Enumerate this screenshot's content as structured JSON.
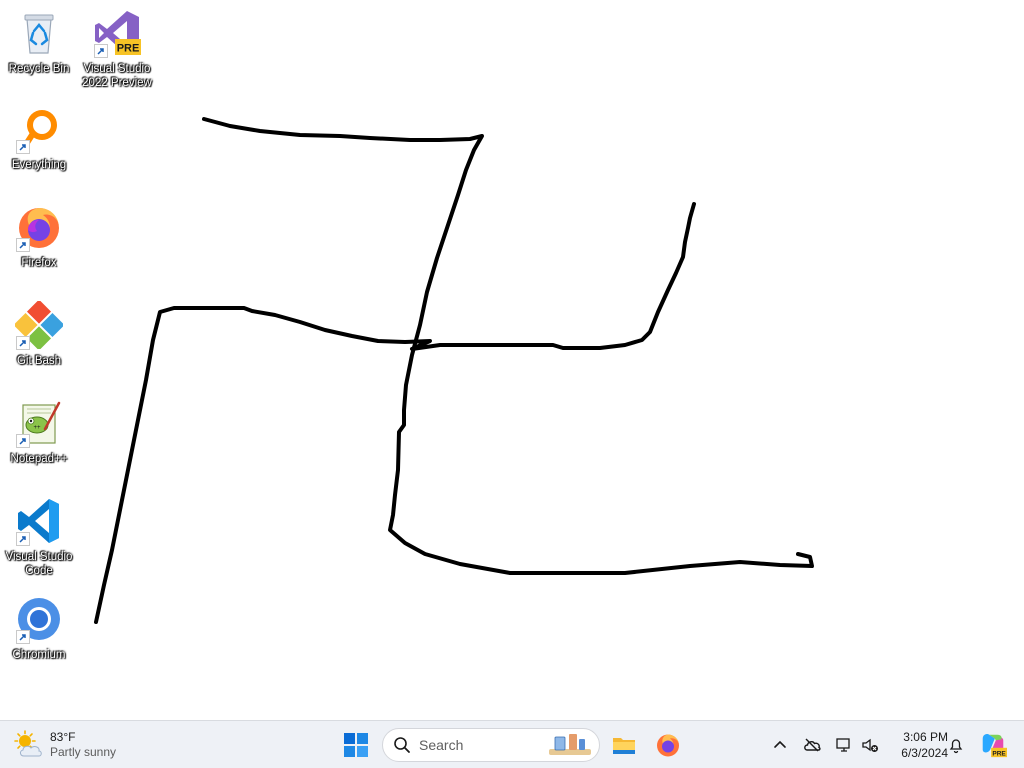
{
  "desktop": {
    "icons": [
      {
        "label": "Recycle Bin",
        "icon": "recycle-bin-icon"
      },
      {
        "label": "Visual Studio 2022 Preview",
        "icon": "visual-studio-preview-icon",
        "badge": "PRE"
      },
      {
        "label": "Everything",
        "icon": "everything-search-icon"
      },
      {
        "label": "Firefox",
        "icon": "firefox-icon"
      },
      {
        "label": "Git Bash",
        "icon": "git-bash-icon"
      },
      {
        "label": "Notepad++",
        "icon": "notepad-plus-plus-icon"
      },
      {
        "label": "Visual Studio Code",
        "icon": "vscode-icon"
      },
      {
        "label": "Chromium",
        "icon": "chromium-icon"
      }
    ],
    "drawing": {
      "stroke_color": "#000000"
    }
  },
  "taskbar": {
    "weather": {
      "temp": "83°F",
      "condition": "Partly sunny",
      "icon": "partly-sunny-icon"
    },
    "start": {
      "icon": "windows-start-icon"
    },
    "search": {
      "placeholder": "Search",
      "icon": "search-icon"
    },
    "pinned": [
      {
        "name": "File Explorer",
        "icon": "file-explorer-icon"
      },
      {
        "name": "Firefox",
        "icon": "firefox-icon"
      }
    ],
    "tray": {
      "icons": [
        "chevron-up-icon",
        "onedrive-icon",
        "network-icon",
        "volume-muted-icon"
      ],
      "time": "3:06 PM",
      "date": "6/3/2024",
      "notification_icon": "bell-icon",
      "copilot_badge": "PRE"
    }
  },
  "colors": {
    "taskbar_bg": "#eef1f6",
    "accent_blue": "#0067c0",
    "vs_purple": "#8661c5",
    "vscode_blue": "#0a7acc"
  }
}
